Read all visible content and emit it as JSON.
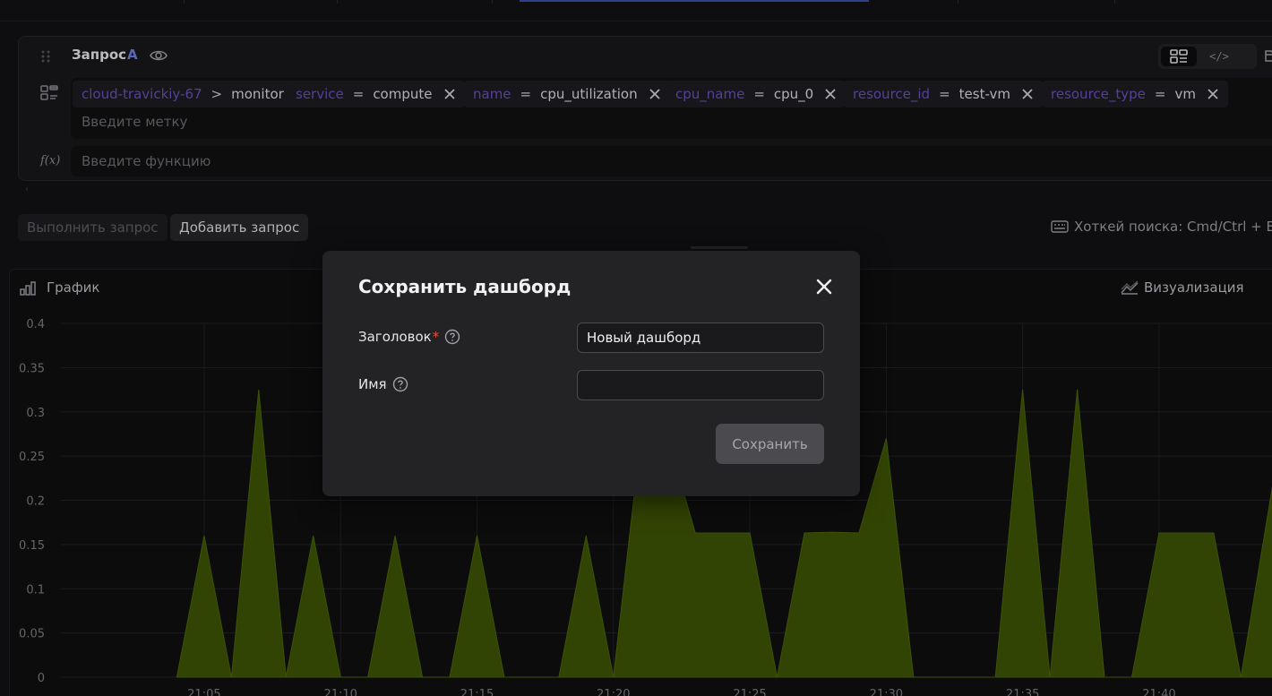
{
  "query": {
    "title": "Запрос",
    "letter": "A",
    "labels": [
      {
        "key": "cloud-travickiy-67",
        "op": ">",
        "value": "monitor",
        "removable": false
      },
      {
        "key": "service",
        "op": "=",
        "value": "compute",
        "removable": true
      },
      {
        "key": "name",
        "op": "=",
        "value": "cpu_utilization",
        "removable": true
      },
      {
        "key": "cpu_name",
        "op": "=",
        "value": "cpu_0",
        "removable": true
      },
      {
        "key": "resource_id",
        "op": "=",
        "value": "test-vm",
        "removable": true
      },
      {
        "key": "resource_type",
        "op": "=",
        "value": "vm",
        "removable": true
      }
    ],
    "label_placeholder": "Введите метку",
    "function_placeholder": "Введите функцию",
    "code_toggle": "</>"
  },
  "actions": {
    "run": "Выполнить запрос",
    "add": "Добавить запрос",
    "hotkey": "Хоткей поиска: Cmd/Ctrl + Ent"
  },
  "graph": {
    "title": "График",
    "visualization": "Визуализация",
    "more": "⋮"
  },
  "chart_data": {
    "type": "area",
    "ylim": [
      0,
      0.4
    ],
    "yticks": [
      "0",
      "0.05",
      "0.1",
      "0.15",
      "0.2",
      "0.25",
      "0.3",
      "0.35",
      "0.4"
    ],
    "xticks": [
      "21:05",
      "21:10",
      "21:15",
      "21:20",
      "21:25",
      "21:30",
      "21:35",
      "21:40"
    ],
    "xlim": [
      "20:59:45",
      "21:44:30"
    ],
    "series": [
      {
        "color": "#3d5406",
        "x": [
          "21:04:00",
          "21:05:00",
          "21:06:00",
          "21:06:00",
          "21:07:00",
          "21:08:00",
          "21:08:00",
          "21:09:00",
          "21:10:00",
          "21:11:00",
          "21:12:00",
          "21:13:00",
          "21:14:00",
          "21:15:00",
          "21:16:00",
          "21:18:00",
          "21:19:00",
          "21:20:00",
          "21:21:00",
          "21:22:00",
          "21:23:00",
          "21:24:00",
          "21:25:00",
          "21:26:00",
          "21:27:00",
          "21:28:00",
          "21:29:00",
          "21:30:00",
          "21:31:00",
          "21:32:00",
          "21:33:00",
          "21:34:00",
          "21:35:00",
          "21:36:00",
          "21:37:00",
          "21:38:00",
          "21:39:00",
          "21:40:00",
          "21:41:00",
          "21:42:00",
          "21:43:00",
          "21:44:30"
        ],
        "values": [
          0,
          0.16,
          0,
          0,
          0.325,
          0,
          0,
          0.16,
          0,
          0,
          0.16,
          0,
          0,
          0.16,
          0,
          0,
          0.16,
          0,
          0.27,
          0.27,
          0.163,
          0.163,
          0.163,
          0,
          0.163,
          0.164,
          0.163,
          0.27,
          0,
          0,
          0,
          0,
          0.325,
          0,
          0.325,
          0,
          0,
          0.163,
          0.163,
          0.163,
          0,
          0.28
        ]
      }
    ]
  },
  "modal": {
    "title": "Сохранить дашборд",
    "title_label": "Заголовок",
    "required_mark": "*",
    "title_value": "Новый дашборд",
    "name_label": "Имя",
    "name_value": "",
    "save": "Сохранить"
  }
}
